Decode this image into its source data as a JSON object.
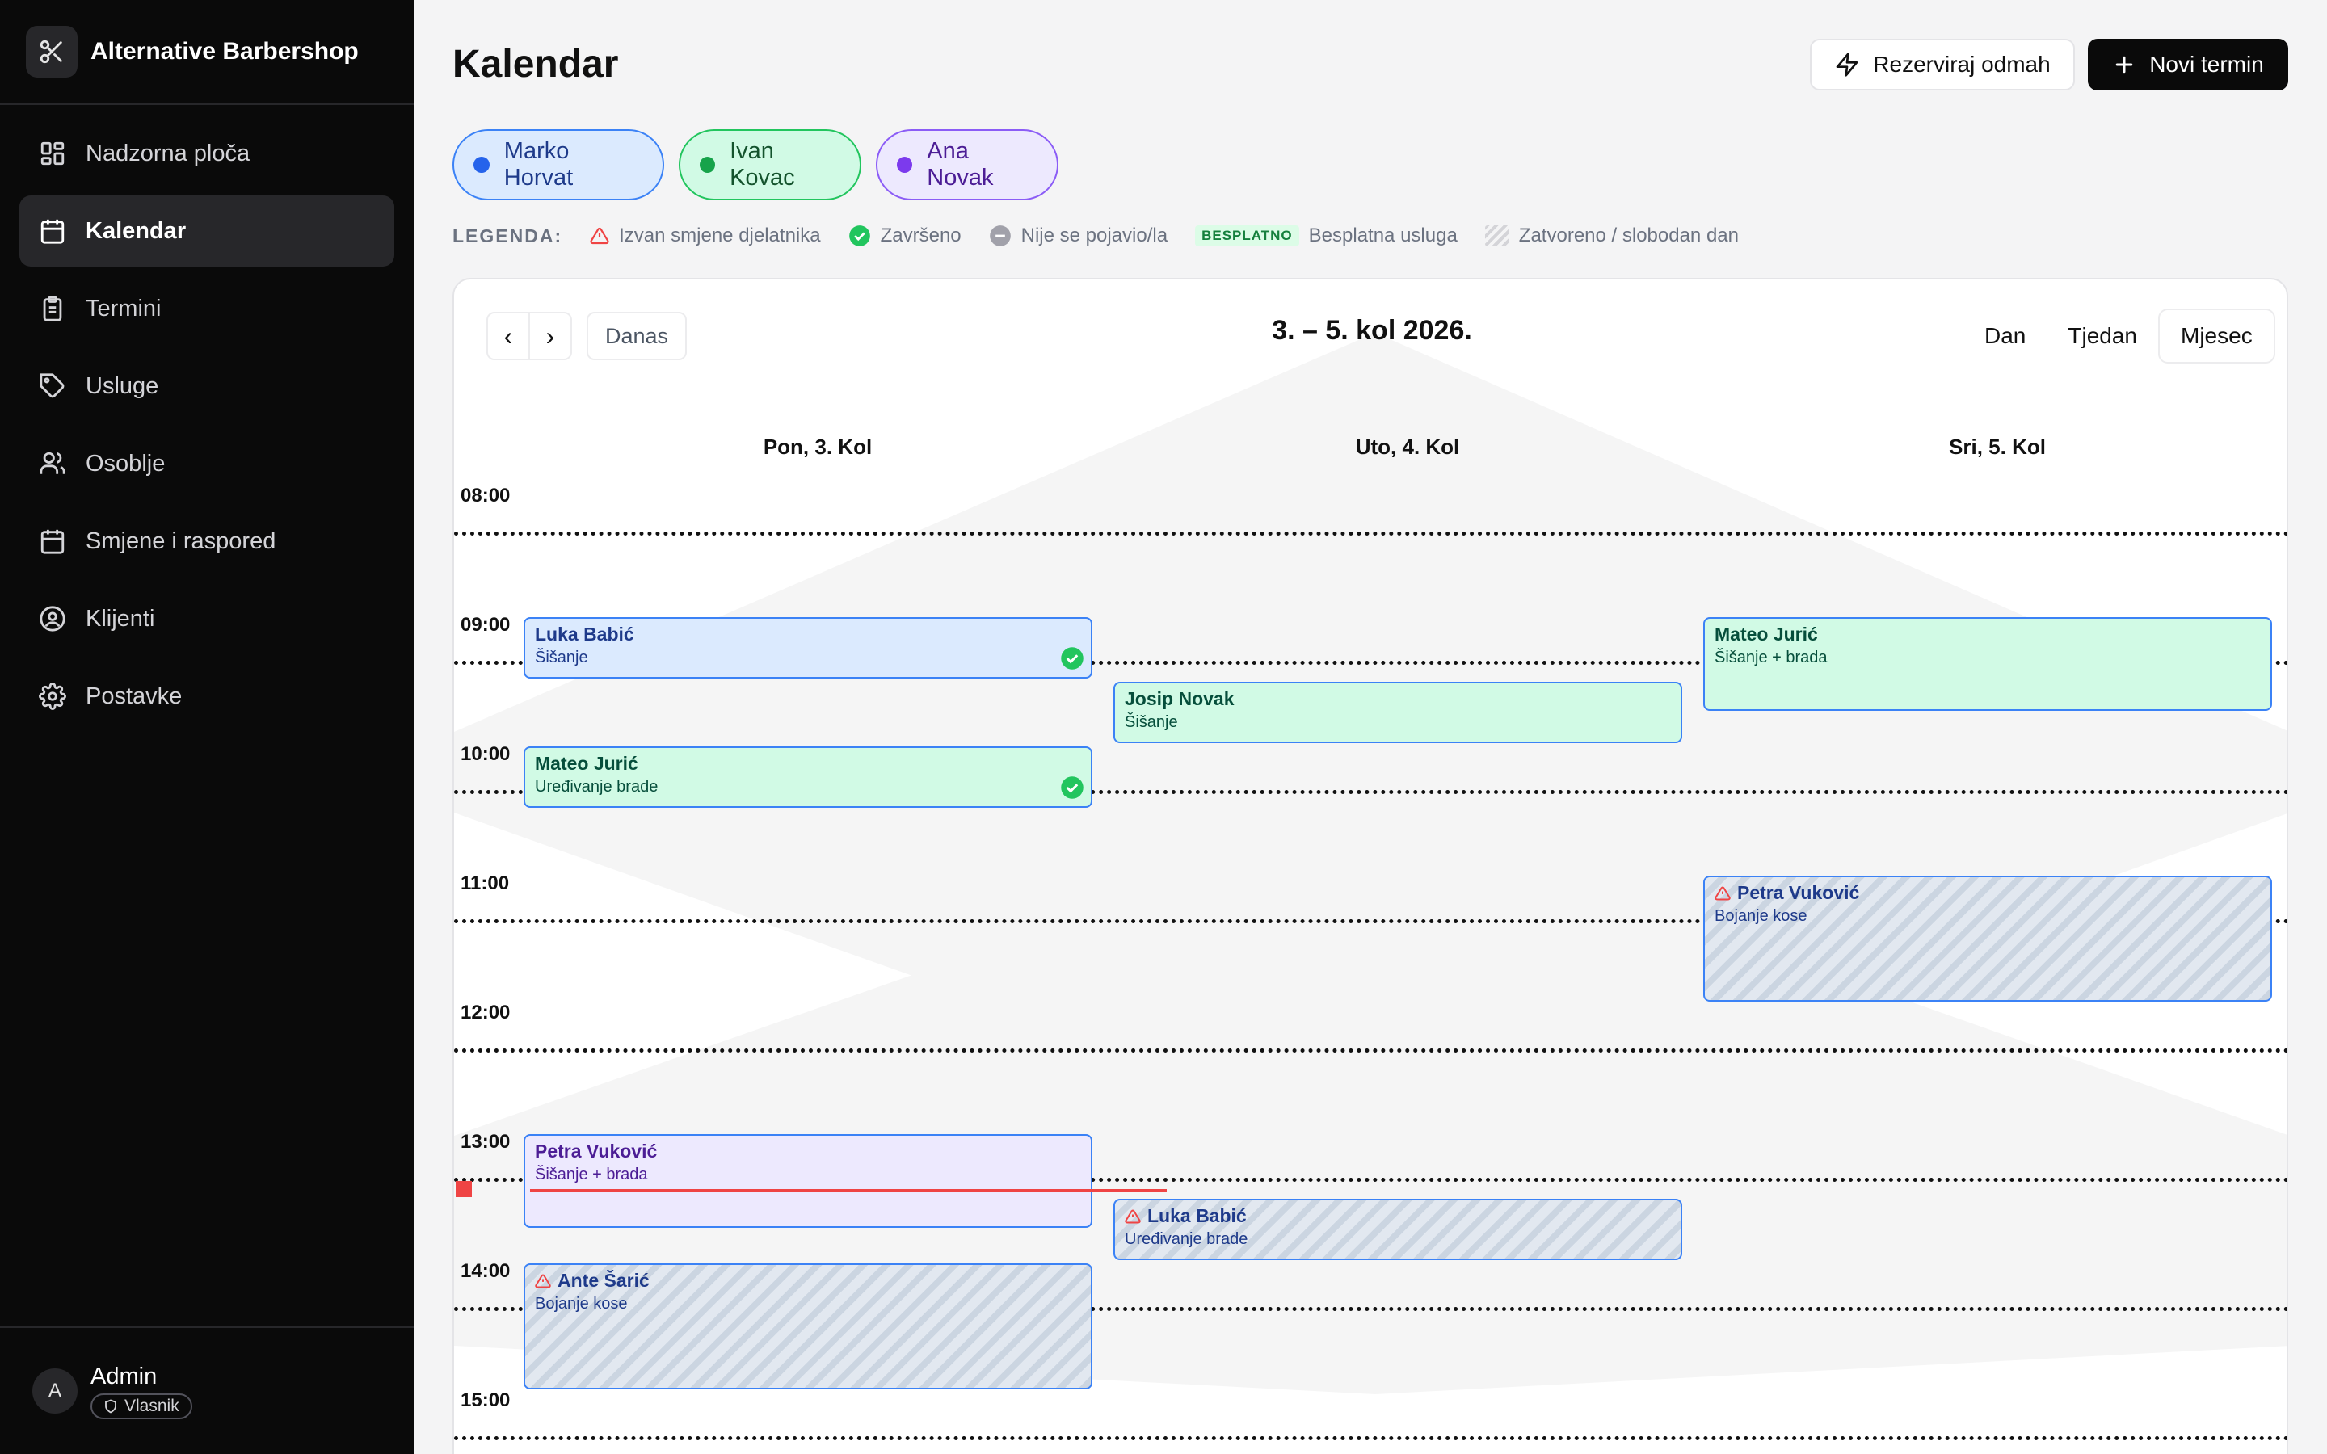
{
  "app": {
    "name": "Alternative Barbershop",
    "logo_icon": "scissors-icon"
  },
  "sidebar": {
    "items": [
      {
        "label": "Nadzorna ploča",
        "icon": "dashboard-icon",
        "active": false
      },
      {
        "label": "Kalendar",
        "icon": "calendar-icon",
        "active": true
      },
      {
        "label": "Termini",
        "icon": "clipboard-icon",
        "active": false
      },
      {
        "label": "Usluge",
        "icon": "tag-icon",
        "active": false
      },
      {
        "label": "Osoblje",
        "icon": "users-icon",
        "active": false
      },
      {
        "label": "Smjene i raspored",
        "icon": "calendar-grid-icon",
        "active": false
      },
      {
        "label": "Klijenti",
        "icon": "user-circle-icon",
        "active": false
      },
      {
        "label": "Postavke",
        "icon": "gear-icon",
        "active": false
      }
    ],
    "user": {
      "initial": "A",
      "name": "Admin",
      "role": "Vlasnik"
    }
  },
  "header": {
    "title": "Kalendar",
    "quick_book_label": "Rezerviraj odmah",
    "new_appointment_label": "Novi termin"
  },
  "staff": [
    {
      "name": "Marko Horvat",
      "color": "#2563eb",
      "bg": "#dbeafe",
      "border": "#3b82f6",
      "text": "#1e3a8a"
    },
    {
      "name": "Ivan Kovac",
      "color": "#16a34a",
      "bg": "#d1fae5",
      "border": "#22c55e",
      "text": "#14532d"
    },
    {
      "name": "Ana Novak",
      "color": "#7c3aed",
      "bg": "#ede9fe",
      "border": "#8b5cf6",
      "text": "#4c1d95"
    }
  ],
  "legend": {
    "title": "LEGENDA:",
    "outside_shift": "Izvan smjene djelatnika",
    "completed": "Završeno",
    "no_show": "Nije se pojavio/la",
    "free_tag": "BESPLATNO",
    "free_service": "Besplatna usluga",
    "closed": "Zatvoreno / slobodan dan"
  },
  "calendar": {
    "range_title": "3. – 5. kol 2026.",
    "today_label": "Danas",
    "prev_label": "‹",
    "next_label": "›",
    "views": [
      "Dan",
      "Tjedan",
      "Mjesec"
    ],
    "active_view": "Mjesec",
    "days": [
      "Pon, 3. Kol",
      "Uto, 4. Kol",
      "Sri, 5. Kol"
    ],
    "hours": [
      "08:00",
      "09:00",
      "10:00",
      "11:00",
      "12:00",
      "13:00",
      "14:00",
      "15:00"
    ],
    "now_time": "13:20",
    "events": [
      {
        "client": "Luka Babić",
        "service": "Šišanje",
        "day": 0,
        "start": "09:00",
        "end": "09:30",
        "style": "blue",
        "completed": true,
        "outside_shift": false
      },
      {
        "client": "Mateo Jurić",
        "service": "Uređivanje brade",
        "day": 0,
        "start": "10:00",
        "end": "10:30",
        "style": "green",
        "completed": true,
        "outside_shift": false
      },
      {
        "client": "Petra Vuković",
        "service": "Šišanje + brada",
        "day": 0,
        "start": "13:00",
        "end": "13:45",
        "style": "purple",
        "completed": false,
        "outside_shift": false
      },
      {
        "client": "Ante Šarić",
        "service": "Bojanje kose",
        "day": 0,
        "start": "14:00",
        "end": "15:00",
        "style": "hatched",
        "completed": false,
        "outside_shift": true
      },
      {
        "client": "Josip Novak",
        "service": "Šišanje",
        "day": 1,
        "start": "09:30",
        "end": "10:00",
        "style": "green",
        "completed": false,
        "outside_shift": false
      },
      {
        "client": "Luka Babić",
        "service": "Uređivanje brade",
        "day": 1,
        "start": "13:30",
        "end": "14:00",
        "style": "hatched",
        "completed": false,
        "outside_shift": true
      },
      {
        "client": "Mateo Jurić",
        "service": "Šišanje + brada",
        "day": 2,
        "start": "09:00",
        "end": "09:45",
        "style": "green",
        "completed": false,
        "outside_shift": false
      },
      {
        "client": "Petra Vuković",
        "service": "Bojanje kose",
        "day": 2,
        "start": "11:00",
        "end": "12:00",
        "style": "hatched",
        "completed": false,
        "outside_shift": true
      }
    ]
  }
}
